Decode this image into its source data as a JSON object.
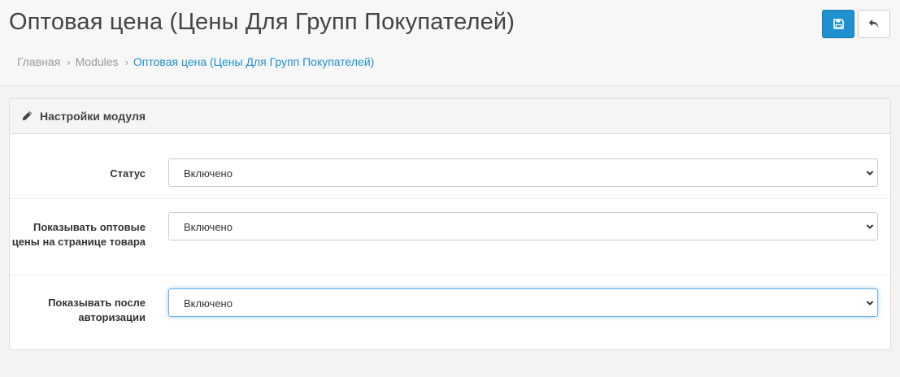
{
  "header": {
    "title": "Оптовая цена (Цены Для Групп Покупателей)",
    "breadcrumb": [
      {
        "label": "Главная"
      },
      {
        "label": "Modules"
      },
      {
        "label": "Оптовая цена (Цены Для Групп Покупателей)"
      }
    ],
    "separator": "›",
    "save_icon": "floppy-disk-icon",
    "back_icon": "reply-arrow-icon"
  },
  "panel": {
    "icon": "pencil-icon",
    "title": "Настройки модуля",
    "fields": [
      {
        "label": "Статус",
        "value": "Включено"
      },
      {
        "label": "Показывать оптовые цены на странице товара",
        "value": "Включено"
      },
      {
        "label": "Показывать после авторизации",
        "value": "Включено"
      }
    ]
  },
  "colors": {
    "primary": "#1e91cf",
    "link": "#1e91cf",
    "focus_border": "#66afe9"
  }
}
